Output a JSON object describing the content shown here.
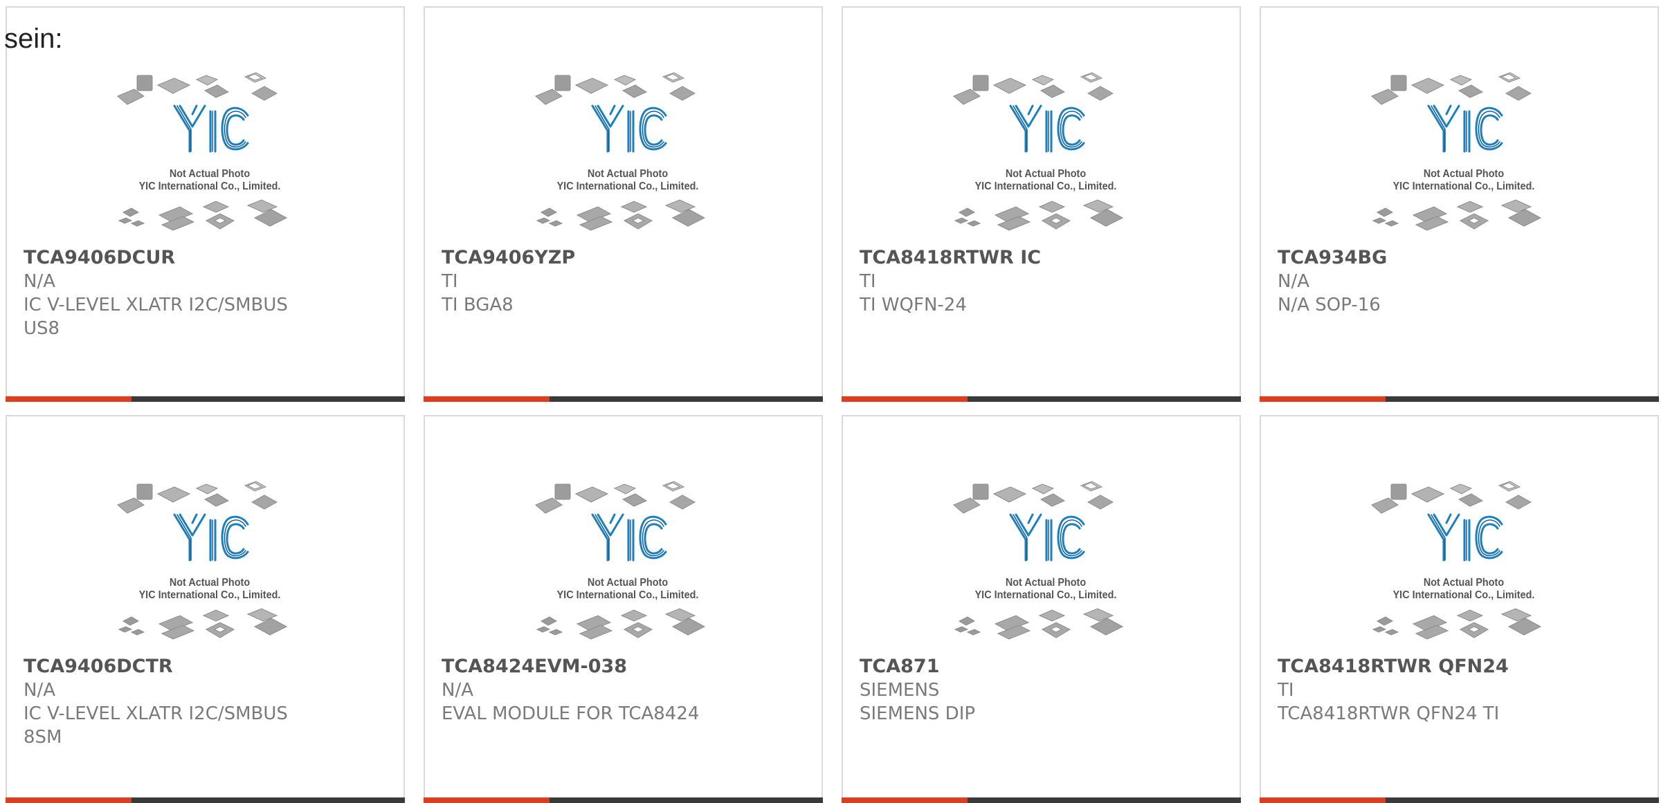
{
  "intro_text": "sein:",
  "placeholder": {
    "logo": "YIC",
    "line1": "Not Actual Photo",
    "line2": "YIC International Co., Limited."
  },
  "colors": {
    "accent": "#e03c1e",
    "bar": "#3a3a3a",
    "border": "#d9d9d9",
    "logo": "#1a7fc1"
  },
  "products": [
    {
      "part": "TCA9406DCUR",
      "maker": "N/A",
      "desc": "IC V-LEVEL XLATR I2C/SMBUS US8"
    },
    {
      "part": "TCA9406YZP",
      "maker": "TI",
      "desc": "TI BGA8"
    },
    {
      "part": "TCA8418RTWR IC",
      "maker": "TI",
      "desc": "TI WQFN-24"
    },
    {
      "part": "TCA934BG",
      "maker": "N/A",
      "desc": "N/A SOP-16"
    },
    {
      "part": "TCA9406DCTR",
      "maker": "N/A",
      "desc": "IC V-LEVEL XLATR I2C/SMBUS 8SM"
    },
    {
      "part": "TCA8424EVM-038",
      "maker": "N/A",
      "desc": "EVAL MODULE FOR TCA8424"
    },
    {
      "part": "TCA871",
      "maker": "SIEMENS",
      "desc": "SIEMENS DIP"
    },
    {
      "part": "TCA8418RTWR QFN24",
      "maker": "TI",
      "desc": "TCA8418RTWR QFN24 TI"
    }
  ]
}
